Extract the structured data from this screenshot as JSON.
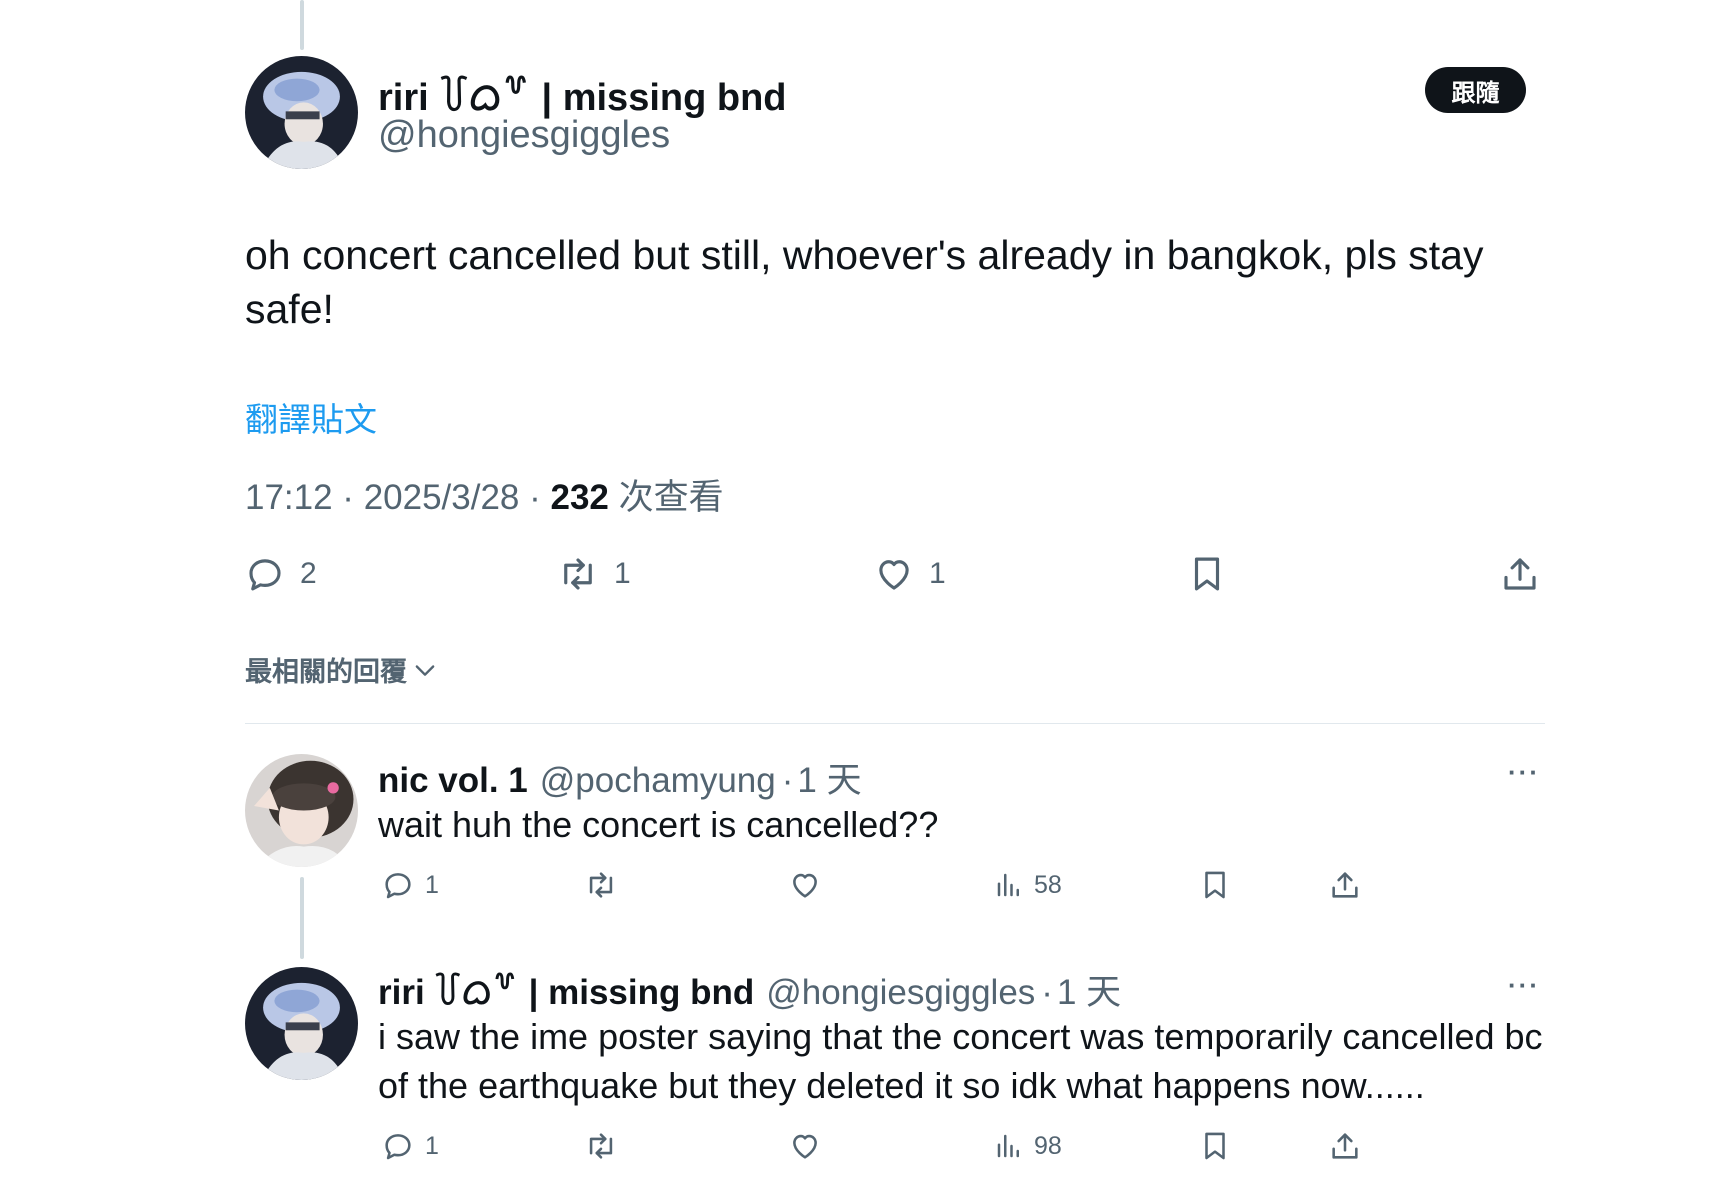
{
  "colors": {
    "accent": "#1d9bf0",
    "text": "#0f1419",
    "muted": "#536471",
    "line": "#cfd9de"
  },
  "main_tweet": {
    "display_name": "riri ꒦ᜊ꒷ | missing bnd",
    "handle": "@hongiesgiggles",
    "follow_label": "跟隨",
    "text": "oh concert cancelled but still, whoever's already in bangkok, pls stay safe!",
    "translate_label": "翻譯貼文",
    "time": "17:12 · 2025/3/28 · ",
    "views_count": "232",
    "views_label": " 次查看",
    "actions": {
      "replies": "2",
      "retweets": "1",
      "likes": "1"
    },
    "icons": [
      "reply-icon",
      "retweet-icon",
      "like-icon",
      "bookmark-icon",
      "share-icon"
    ]
  },
  "sort_label": "最相關的回覆",
  "replies": [
    {
      "display_name": "nic vol. 1",
      "handle": "@pochamyung",
      "dot": "·",
      "time": "1 天",
      "text": "wait huh the concert is cancelled??",
      "more": "···",
      "actions": {
        "replies": "1",
        "retweets": "",
        "likes": "",
        "views": "58"
      }
    },
    {
      "display_name": "riri ꒦ᜊ꒷ | missing bnd",
      "handle": "@hongiesgiggles",
      "dot": "·",
      "time": "1 天",
      "text": "i saw the ime poster saying that the concert was temporarily cancelled bc of the earthquake but they deleted it so idk what happens now......",
      "more": "···",
      "actions": {
        "replies": "1",
        "retweets": "",
        "likes": "",
        "views": "98"
      }
    }
  ]
}
